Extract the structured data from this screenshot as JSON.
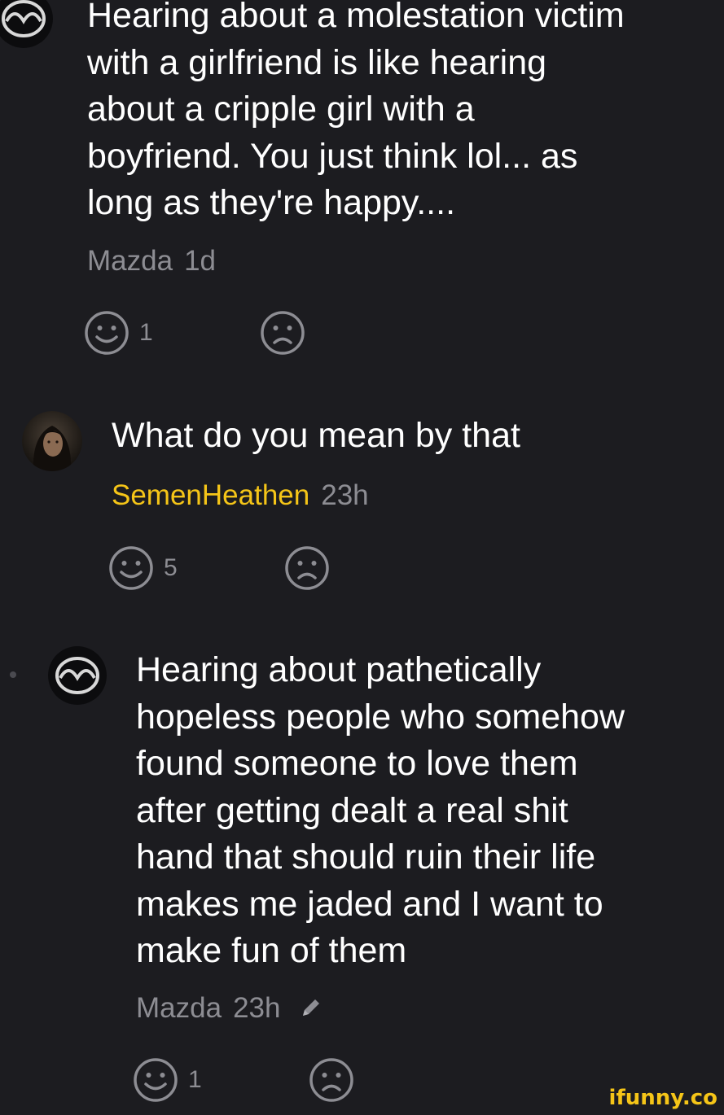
{
  "comments": [
    {
      "avatar_icon": "mazda-logo-icon",
      "text": "Hearing about a molestation victim\nwith a girlfriend is like hearing\nabout a cripple girl with a\nboyfriend. You just think lol... as\nlong as they're happy....",
      "author": "Mazda",
      "time": "1d",
      "smiles": "1",
      "smile_icon": "smile-icon",
      "frown_icon": "frown-icon"
    },
    {
      "avatar_icon": "user-photo-avatar",
      "text": "What do you mean by that",
      "author": "SemenHeathen",
      "author_color": "#f5c518",
      "time": "23h",
      "smiles": "5",
      "smile_icon": "smile-icon",
      "frown_icon": "frown-icon"
    },
    {
      "avatar_icon": "mazda-logo-icon",
      "text": "Hearing about pathetically\nhopeless people who somehow\nfound someone to love them\nafter getting dealt a real shit\nhand that should ruin their life\nmakes me jaded and I want to\nmake fun of them",
      "author": "Mazda",
      "time": "23h",
      "edited_icon": "pencil-icon",
      "smiles": "1",
      "smile_icon": "smile-icon",
      "frown_icon": "frown-icon"
    }
  ],
  "watermark": "ifunny.co",
  "colors": {
    "background": "#1c1c20",
    "text": "#ffffff",
    "meta": "#8d8d93",
    "highlight_author": "#f5c518"
  }
}
